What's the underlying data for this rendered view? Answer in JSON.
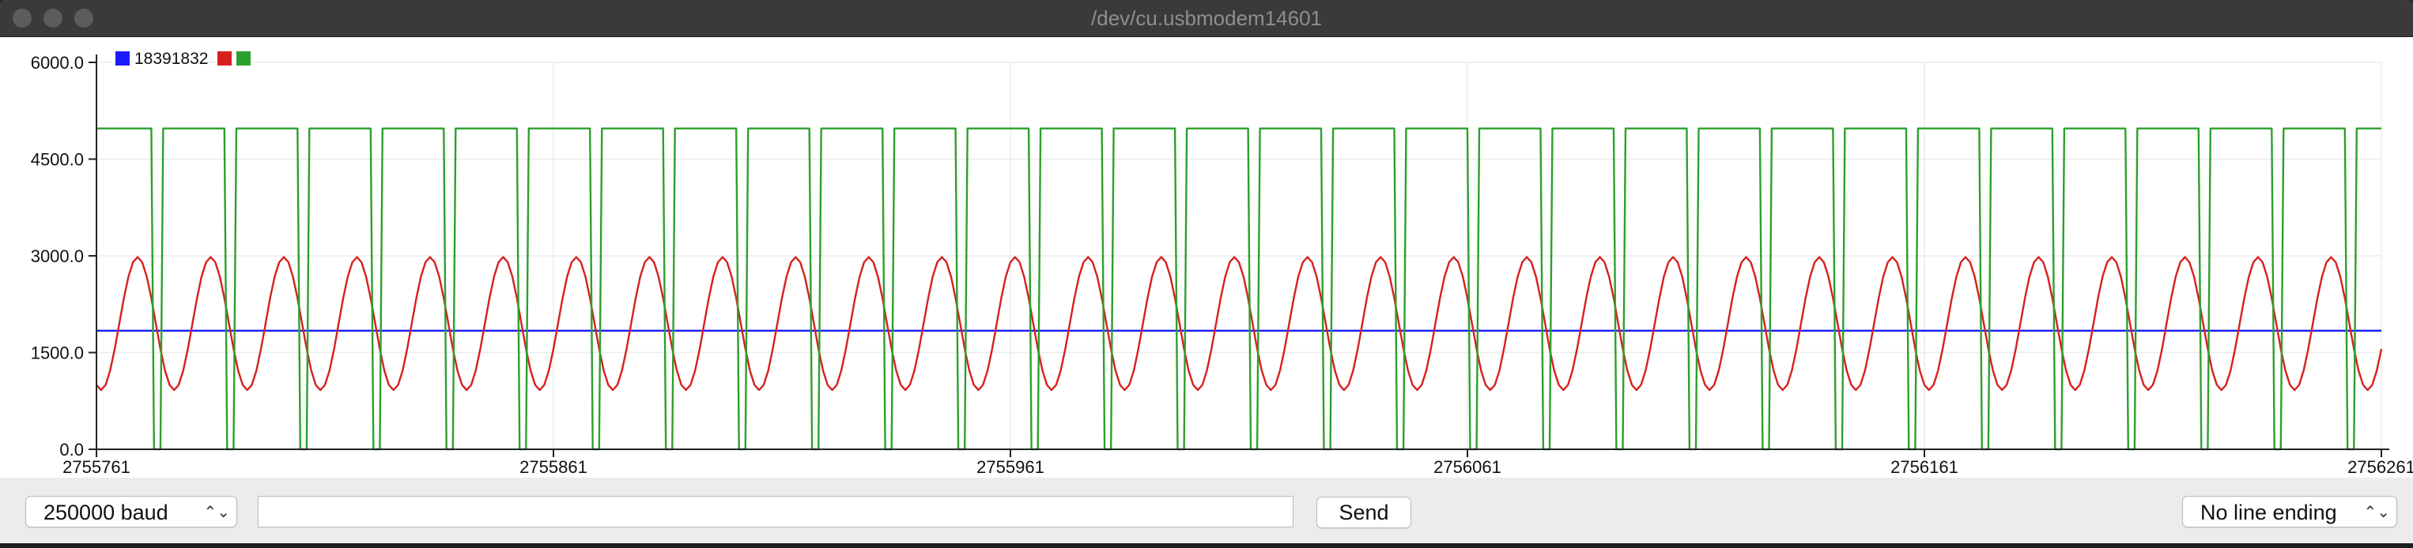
{
  "window": {
    "title": "/dev/cu.usbmodem14601"
  },
  "controls": {
    "baud_label": "250000 baud",
    "serial_input_value": "",
    "send_label": "Send",
    "line_ending_label": "No line ending"
  },
  "chart_data": {
    "type": "line",
    "grid": true,
    "legend_position": "top-left",
    "legend_labels": [
      "1839",
      "1832"
    ],
    "legend_label_text": "18391832",
    "ylim": [
      0,
      6000
    ],
    "yticks": [
      "6000.0",
      "4500.0",
      "3000.0",
      "1500.0",
      "0.0"
    ],
    "xlim": [
      2755761,
      2756261
    ],
    "xticks": [
      "2755761",
      "2755861",
      "2755961",
      "2756061",
      "2756161",
      "2756261"
    ],
    "series": [
      {
        "name": "1839",
        "color": "#1a1aff",
        "kind": "constant",
        "value": 1839
      },
      {
        "name": "",
        "color": "#d62020",
        "kind": "sine",
        "center": 1950,
        "amplitude": 1030,
        "period": 16,
        "phase_x": 2755770
      },
      {
        "name": "",
        "color": "#2ca02c",
        "kind": "square",
        "high": 4975,
        "low": 0,
        "period": 16,
        "drop_x": 2755773,
        "low_width": 2
      }
    ]
  }
}
